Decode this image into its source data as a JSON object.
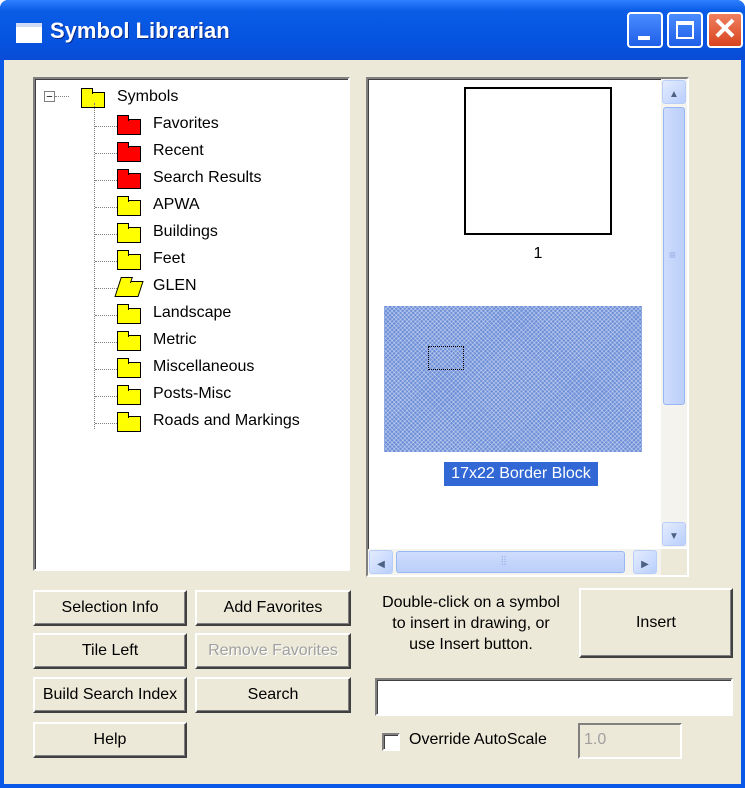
{
  "window": {
    "title": "Symbol Librarian"
  },
  "tree": {
    "root_label": "Symbols",
    "root_expander": "−",
    "items": [
      {
        "label": "Favorites",
        "color": "red"
      },
      {
        "label": "Recent",
        "color": "red"
      },
      {
        "label": "Search Results",
        "color": "red"
      },
      {
        "label": "APWA",
        "color": "yellow"
      },
      {
        "label": "Buildings",
        "color": "yellow"
      },
      {
        "label": "Feet",
        "color": "yellow"
      },
      {
        "label": "GLEN",
        "color": "yellow",
        "open": true
      },
      {
        "label": "Landscape",
        "color": "yellow"
      },
      {
        "label": "Metric",
        "color": "yellow"
      },
      {
        "label": "Miscellaneous",
        "color": "yellow"
      },
      {
        "label": "Posts-Misc",
        "color": "yellow"
      },
      {
        "label": "Roads and Markings",
        "color": "yellow"
      }
    ]
  },
  "preview": {
    "symbols": [
      {
        "caption": "1",
        "selected": false
      },
      {
        "caption": "17x22 Border Block",
        "selected": true
      }
    ],
    "selection_color": "#3168d5"
  },
  "buttons": {
    "selection_info": "Selection Info",
    "add_favorites": "Add Favorites",
    "tile_left": "Tile Left",
    "remove_favorites": "Remove Favorites",
    "build_search_index": "Build Search Index",
    "search": "Search",
    "help": "Help",
    "insert": "Insert"
  },
  "instruction": {
    "line1": "Double-click on a symbol",
    "line2": "to insert in drawing, or",
    "line3": "use Insert button."
  },
  "search_field": {
    "value": ""
  },
  "override_autoscale": {
    "label": "Override AutoScale",
    "checked": false,
    "value": "1.0"
  },
  "icons": {
    "scroll_up": "▲",
    "scroll_down": "▼",
    "scroll_left": "◀",
    "scroll_right": "▶"
  },
  "colors": {
    "titlebar": "#0553e0",
    "dialog_bg": "#ece9d8",
    "folder_yellow": "#ffff00",
    "folder_red": "#ff0000"
  }
}
